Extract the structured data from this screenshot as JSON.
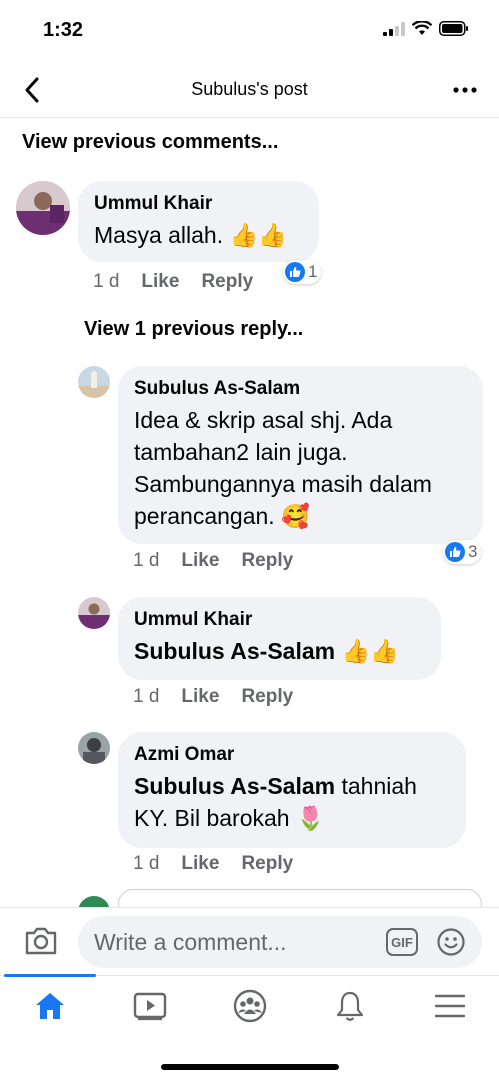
{
  "status": {
    "time": "1:32"
  },
  "header": {
    "title": "Subulus's post"
  },
  "view_previous_comments": "View previous comments...",
  "view_previous_reply": "View 1 previous reply...",
  "comments": [
    {
      "author": "Ummul Khair",
      "text": "Masya allah. 👍👍",
      "time": "1 d",
      "like": "Like",
      "reply": "Reply",
      "reactions": "1"
    },
    {
      "author": "Subulus As-Salam",
      "lines": [
        "Idea & skrip asal shj. Ada",
        "tambahan2 lain juga.",
        "Sambungannya masih dalam",
        "perancangan. 🥰"
      ],
      "time": "1 d",
      "like": "Like",
      "reply": "Reply",
      "reactions": "3"
    },
    {
      "author": "Ummul Khair",
      "mention": "Subulus As-Salam",
      "text": " 👍👍",
      "time": "1 d",
      "like": "Like",
      "reply": "Reply"
    },
    {
      "author": "Azmi Omar",
      "mention": "Subulus As-Salam",
      "text": " tahniah",
      "text2": "KY. Bil barokah 🌷",
      "time": "1 d",
      "like": "Like",
      "reply": "Reply"
    }
  ],
  "composer": {
    "placeholder": "Write a comment...",
    "gif": "GIF"
  },
  "tabs": [
    "home-icon",
    "video-icon",
    "groups-icon",
    "bell-icon",
    "menu-icon"
  ],
  "colors": {
    "accent": "#1877f2",
    "bubble": "#f0f2f5",
    "muted": "#65676b"
  }
}
